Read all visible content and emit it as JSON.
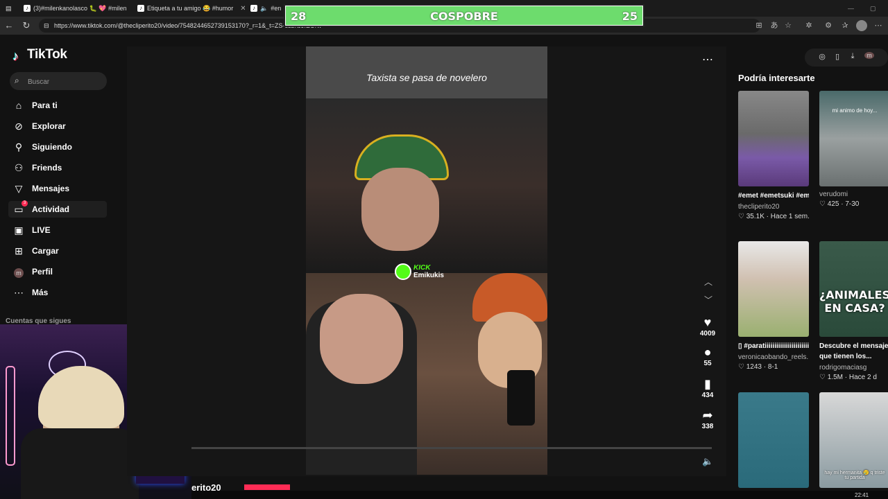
{
  "browser": {
    "tabs": [
      {
        "label": "(3)#milenkanolasco 🐛 💖 #milen"
      },
      {
        "label": "Etiqueta a tu amigo 😂 #humor"
      },
      {
        "label": "#en"
      }
    ],
    "url": "https://www.tiktok.com/@thecliperito20/video/7548244652739153170?_r=1&_t=ZS-8zzhJJfEOrw"
  },
  "overlay": {
    "left_score": "28",
    "title": "COSPOBRE",
    "right_score": "25"
  },
  "sidebar": {
    "logo": "TikTok",
    "search_placeholder": "Buscar",
    "items": [
      {
        "label": "Para ti",
        "icon": "home-icon"
      },
      {
        "label": "Explorar",
        "icon": "compass-icon"
      },
      {
        "label": "Siguiendo",
        "icon": "following-icon"
      },
      {
        "label": "Friends",
        "icon": "friends-icon"
      },
      {
        "label": "Mensajes",
        "icon": "messages-icon"
      },
      {
        "label": "Actividad",
        "icon": "activity-icon",
        "badge": "3"
      },
      {
        "label": "LIVE",
        "icon": "live-icon"
      },
      {
        "label": "Cargar",
        "icon": "upload-icon"
      },
      {
        "label": "Perfil",
        "icon": "profile-avatar",
        "avatar": "m"
      },
      {
        "label": "Más",
        "icon": "more-icon"
      }
    ],
    "following_heading": "Cuentas que sigues"
  },
  "video": {
    "caption": "Taxista se pasa de novelero",
    "kick_brand": "KICK",
    "kick_user": "Emikukis",
    "likes": "4009",
    "comments": "55",
    "saves": "434",
    "shares": "338",
    "progress": 0.0,
    "author_partial": "erito20"
  },
  "right_panel": {
    "title": "Podría interesarte",
    "toolbar_avatar": "m",
    "cards": [
      {
        "caption": "#emet #emetsuki #emetsukiclips...",
        "user": "thecliperito20",
        "likes": "35.1K",
        "date": "Hace 1 sem.",
        "overlay": ""
      },
      {
        "caption": "",
        "user": "verudomi",
        "likes": "425",
        "date": "7-30",
        "overlay": "mi animo de hoy..."
      },
      {
        "caption": "▯ #paratiiiiiiiiiiiiiiiiiiiiiii...",
        "user": "veronicaobando_reels...",
        "likes": "1243",
        "date": "8-1",
        "overlay": ""
      },
      {
        "caption": "Descubre el mensaje que tienen los...",
        "user": "rodrigomaciasg",
        "likes": "1.5M",
        "date": "Hace 2 d",
        "overlay": "¿ANIMALES EN CASA?"
      },
      {
        "caption": "",
        "user": "",
        "likes": "",
        "date": "",
        "overlay": ""
      },
      {
        "caption": "",
        "user": "",
        "likes": "",
        "date": "",
        "overlay": "hay mi hermanita 😢 q triste tu partida"
      }
    ]
  },
  "taskbar": {
    "clock": "22:41"
  },
  "colors": {
    "accent": "#fe2c55",
    "banner": "#6ddc6d",
    "kick_green": "#53fc18"
  }
}
